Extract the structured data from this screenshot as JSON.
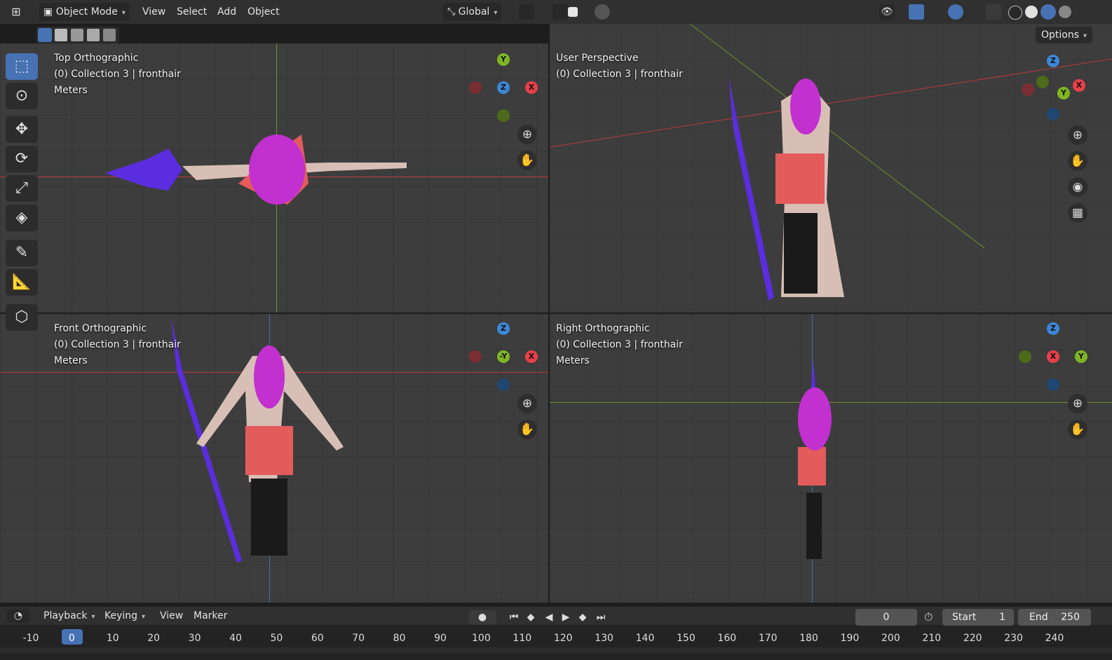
{
  "header": {
    "mode": "Object Mode",
    "menus": [
      "View",
      "Select",
      "Add",
      "Object"
    ],
    "orientation": "Global",
    "options_label": "Options"
  },
  "viewports": [
    {
      "name": "Top Orthographic",
      "collection": "(0) Collection 3 | fronthair",
      "units": "Meters",
      "gizmo": {
        "center": "Z",
        "labels": [
          "Y",
          "X"
        ]
      }
    },
    {
      "name": "User Perspective",
      "collection": "(0) Collection 3 | fronthair",
      "units": "",
      "gizmo": {
        "center": "",
        "labels": [
          "Z",
          "Y",
          "X"
        ]
      }
    },
    {
      "name": "Front Orthographic",
      "collection": "(0) Collection 3 | fronthair",
      "units": "Meters",
      "gizmo": {
        "center": "-Y",
        "labels": [
          "Z",
          "X"
        ]
      }
    },
    {
      "name": "Right Orthographic",
      "collection": "(0) Collection 3 | fronthair",
      "units": "Meters",
      "gizmo": {
        "center": "X",
        "labels": [
          "Z",
          "Y"
        ]
      }
    }
  ],
  "toolbar": [
    "select-box-icon",
    "cursor-icon",
    "move-icon",
    "rotate-icon",
    "scale-icon",
    "transform-icon",
    "annotate-icon",
    "measure-icon",
    "add-cube-icon"
  ],
  "timeline": {
    "menus": [
      "Playback",
      "Keying",
      "View",
      "Marker"
    ],
    "current_frame": "0",
    "start_label": "Start",
    "start_value": "1",
    "end_label": "End",
    "end_value": "250",
    "ticks": [
      "-10",
      "0",
      "10",
      "20",
      "30",
      "40",
      "50",
      "60",
      "70",
      "80",
      "90",
      "100",
      "110",
      "120",
      "130",
      "140",
      "150",
      "160",
      "170",
      "180",
      "190",
      "200",
      "210",
      "220",
      "230",
      "240"
    ]
  },
  "colors": {
    "x_axis": "#e8404a",
    "y_axis": "#7fb523",
    "z_axis": "#3d86d6",
    "accent": "#4772b3"
  }
}
